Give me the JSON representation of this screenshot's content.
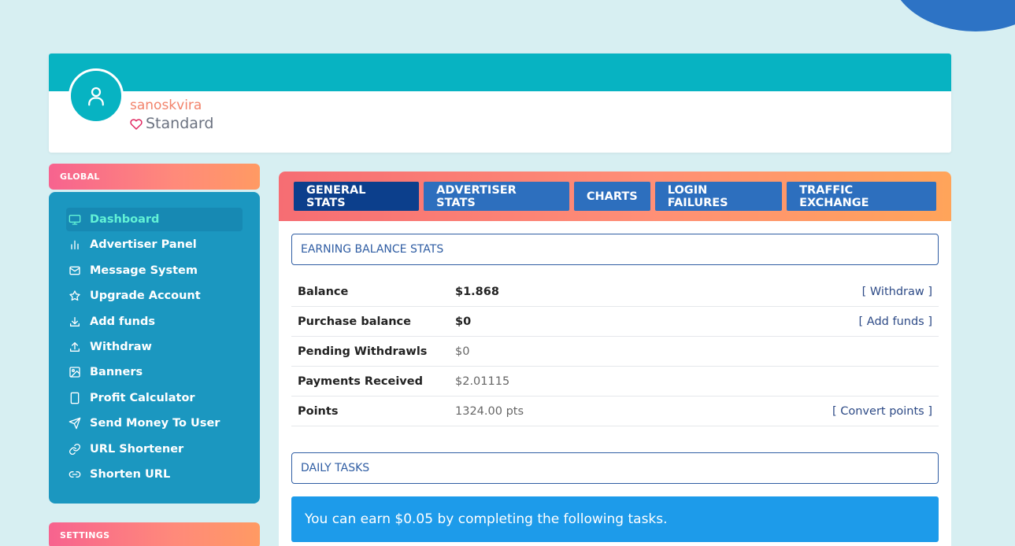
{
  "profile": {
    "username": "sanoskvira",
    "membership": "Standard"
  },
  "sidebar": {
    "global_header": "GLOBAL",
    "settings_header": "SETTINGS",
    "items": [
      {
        "label": "Dashboard",
        "icon": "monitor-icon",
        "active": true
      },
      {
        "label": "Advertiser Panel",
        "icon": "bar-chart-icon"
      },
      {
        "label": "Message System",
        "icon": "mail-icon"
      },
      {
        "label": "Upgrade Account",
        "icon": "star-icon"
      },
      {
        "label": "Add funds",
        "icon": "download-icon"
      },
      {
        "label": "Withdraw",
        "icon": "upload-icon"
      },
      {
        "label": "Banners",
        "icon": "image-icon"
      },
      {
        "label": "Profit Calculator",
        "icon": "calculator-icon"
      },
      {
        "label": "Send Money To User",
        "icon": "send-icon"
      },
      {
        "label": "URL Shortener",
        "icon": "link-icon"
      },
      {
        "label": "Shorten URL",
        "icon": "link-alt-icon"
      }
    ]
  },
  "tabs": [
    {
      "label": "GENERAL STATS",
      "active": true
    },
    {
      "label": "ADVERTISER STATS"
    },
    {
      "label": "CHARTS"
    },
    {
      "label": "LOGIN FAILURES"
    },
    {
      "label": "TRAFFIC EXCHANGE"
    }
  ],
  "earning": {
    "title": "EARNING BALANCE STATS",
    "rows": [
      {
        "label": "Balance",
        "value": "$1.868",
        "action": "[ Withdraw ]"
      },
      {
        "label": "Purchase balance",
        "value": "$0",
        "action": "[ Add funds ]"
      },
      {
        "label": "Pending Withdrawls",
        "value": "$0",
        "action": ""
      },
      {
        "label": "Payments Received",
        "value": "$2.01115",
        "action": ""
      },
      {
        "label": "Points",
        "value": "1324.00 pts",
        "action": "[ Convert points ]"
      }
    ]
  },
  "daily_tasks": {
    "title": "DAILY TASKS",
    "message": "You can earn $0.05 by completing the following tasks."
  },
  "colors": {
    "accent_teal": "#07b3c2",
    "sidebar_blue": "#1b97c0",
    "tab_blue": "#2d6fbe",
    "tab_active": "#0c3f8c",
    "info_blue": "#1d9bea"
  }
}
